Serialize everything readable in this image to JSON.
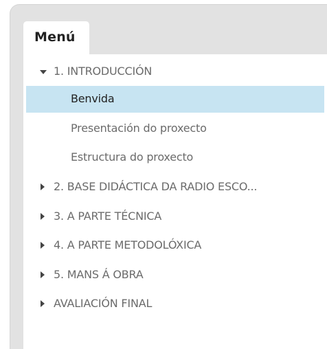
{
  "menu": {
    "tab_label": "Menú",
    "items": [
      {
        "label": "1. INTRODUCCIÓN",
        "level": 1,
        "expanded": true
      },
      {
        "label": "Benvida",
        "level": 2,
        "selected": true
      },
      {
        "label": "Presentación do proxecto",
        "level": 2
      },
      {
        "label": "Estructura do proxecto",
        "level": 2
      },
      {
        "label": "2. BASE DIDÁCTICA DA RADIO ESCO...",
        "level": 1,
        "expanded": false
      },
      {
        "label": "3. A PARTE TÉCNICA",
        "level": 1,
        "expanded": false
      },
      {
        "label": "4. A PARTE METODOLÓXICA",
        "level": 1,
        "expanded": false
      },
      {
        "label": "5. MANS Á OBRA",
        "level": 1,
        "expanded": false
      },
      {
        "label": "AVALIACIÓN FINAL",
        "level": 1,
        "expanded": false
      }
    ]
  },
  "colors": {
    "panel_background": "#e2e2e2",
    "selected_background": "#c7e4f2",
    "item_text": "#6b6b6b",
    "selected_text": "#222222",
    "arrow": "#444444"
  },
  "icons": {
    "expanded": "triangle-down-icon",
    "collapsed": "triangle-right-icon"
  }
}
